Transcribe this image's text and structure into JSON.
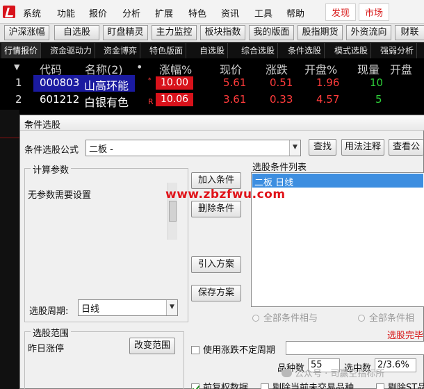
{
  "menu": [
    "系统",
    "功能",
    "报价",
    "分析",
    "扩展",
    "特色",
    "资讯",
    "工具",
    "帮助"
  ],
  "menu_right": [
    "发现",
    "市场"
  ],
  "toolbar": [
    "沪深涨幅",
    "自选股",
    "盯盘精灵",
    "主力监控",
    "板块指数",
    "我的版面",
    "股指期货",
    "外资流向",
    "财联"
  ],
  "tabs": [
    "行情报价",
    "资金驱动力",
    "资金博弈",
    "特色版面",
    "自选股",
    "综合选股",
    "条件选股",
    "模式选股",
    "强弱分析"
  ],
  "quote": {
    "headers": {
      "code": "代码",
      "name": "名称(2)",
      "dot": "•",
      "change_pct": "涨幅%",
      "price": "现价",
      "change": "涨跌",
      "open_pct": "开盘%",
      "volume": "现量",
      "open": "开盘"
    },
    "rows": [
      {
        "idx": "1",
        "code": "000803",
        "name": "山高环能",
        "flag": "*",
        "change_pct": "10.00",
        "price": "5.61",
        "change": "0.51",
        "open_pct": "1.96",
        "volume": "10"
      },
      {
        "idx": "2",
        "code": "601212",
        "name": "白银有色",
        "flag": "R",
        "change_pct": "10.06",
        "price": "3.61",
        "change": "0.33",
        "open_pct": "4.57",
        "volume": "5"
      }
    ]
  },
  "dialog": {
    "title": "条件选股",
    "close_label": "—",
    "formula_label": "条件选股公式",
    "formula_value": "二板  -",
    "btn_find": "查找",
    "btn_usage": "用法注释",
    "btn_view": "查看公",
    "params_title": "计算参数",
    "params_text": "无参数需要设置",
    "period_label": "选股周期:",
    "period_value": "日线",
    "btn_add": "加入条件",
    "btn_delete": "删除条件",
    "btn_import": "引入方案",
    "btn_save": "保存方案",
    "list_title": "选股条件列表",
    "list_items": [
      "二板  日线"
    ],
    "radio_and": "全部条件相与",
    "radio_or": "全部条件相",
    "status_text": "选股完毕",
    "range_title": "选股范围",
    "range_value": "昨日涨停",
    "btn_range": "改变范围",
    "use_uncertain_label": "使用涨跌不定周期",
    "count_label": "品种数",
    "count_value": "55",
    "selected_label": "选中数",
    "selected_value": "2/3.6%",
    "fq_label": "前复权数据",
    "exclude_label": "剔除当前未交易品种",
    "exclude_st_label": "剔除ST品"
  },
  "watermark": "www.zbzfwu.com",
  "wechat": "公众号 · 司赢空指标所",
  "colors": {
    "up_red": "#ff3b3b",
    "down_green": "#2fd23a",
    "selected_row": "#1a1aa0",
    "selection_blue": "#3d8ee0",
    "brand_red": "#d8121b"
  }
}
